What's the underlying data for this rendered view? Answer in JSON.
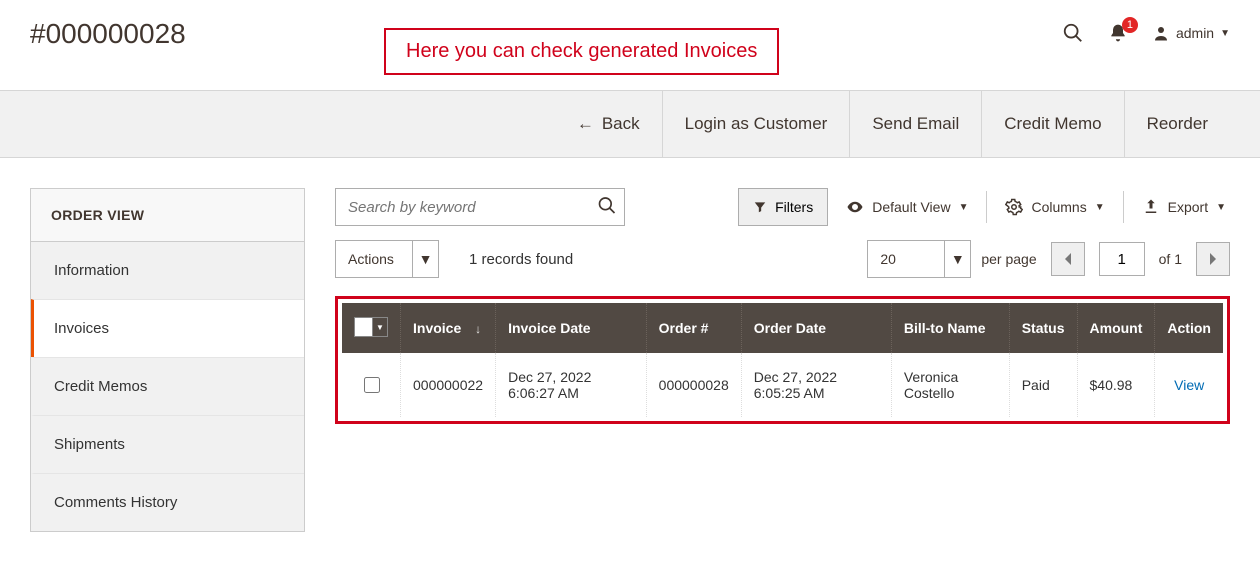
{
  "header": {
    "page_title": "#000000028",
    "annotation": "Here you can check generated Invoices",
    "notification_count": "1",
    "user_label": "admin"
  },
  "top_actions": {
    "back": "Back",
    "login_as_customer": "Login as Customer",
    "send_email": "Send Email",
    "credit_memo": "Credit Memo",
    "reorder": "Reorder"
  },
  "sidebar": {
    "title": "ORDER VIEW",
    "items": [
      {
        "label": "Information"
      },
      {
        "label": "Invoices"
      },
      {
        "label": "Credit Memos"
      },
      {
        "label": "Shipments"
      },
      {
        "label": "Comments History"
      }
    ],
    "active_index": 1
  },
  "toolbar": {
    "search_placeholder": "Search by keyword",
    "filters_label": "Filters",
    "default_view_label": "Default View",
    "columns_label": "Columns",
    "export_label": "Export",
    "actions_label": "Actions",
    "records_found": "1 records found",
    "page_size": "20",
    "per_page_label": "per page",
    "page_current": "1",
    "of_label": "of",
    "total_pages": "1"
  },
  "table": {
    "columns": {
      "invoice": "Invoice",
      "invoice_date": "Invoice Date",
      "order_num": "Order #",
      "order_date": "Order Date",
      "bill_to": "Bill-to Name",
      "status": "Status",
      "amount": "Amount",
      "action": "Action"
    },
    "rows": [
      {
        "invoice": "000000022",
        "invoice_date": "Dec 27, 2022 6:06:27 AM",
        "order_num": "000000028",
        "order_date": "Dec 27, 2022 6:05:25 AM",
        "bill_to": "Veronica Costello",
        "status": "Paid",
        "amount": "$40.98",
        "action": "View"
      }
    ]
  }
}
